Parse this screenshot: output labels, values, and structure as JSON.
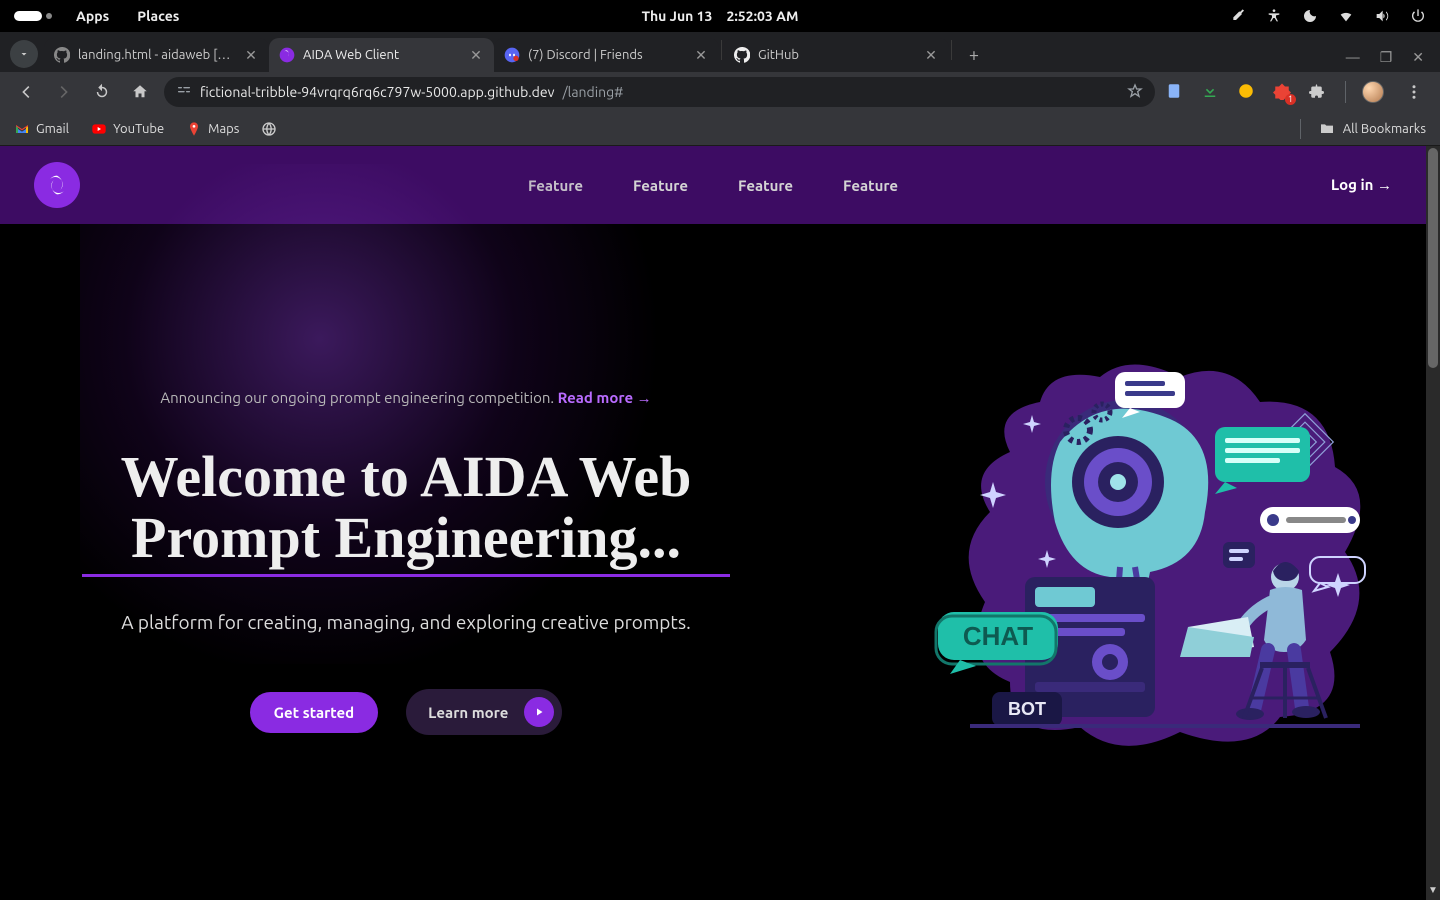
{
  "gnome": {
    "apps": "Apps",
    "places": "Places",
    "date": "Thu Jun 13",
    "time": "2:52:03 AM"
  },
  "chrome": {
    "tabs": [
      {
        "title": "landing.html - aidaweb […"
      },
      {
        "title": "AIDA Web Client"
      },
      {
        "title": "(7) Discord | Friends"
      },
      {
        "title": "GitHub"
      }
    ],
    "url_main": "fictional-tribble-94vrqrq6rq6c797w-5000.app.github.dev",
    "url_tail": "/landing#",
    "ext_badge_count": "1",
    "bookmarks": {
      "gmail": "Gmail",
      "youtube": "YouTube",
      "maps": "Maps",
      "all": "All Bookmarks"
    }
  },
  "site": {
    "nav_items": [
      "Feature",
      "Feature",
      "Feature",
      "Feature"
    ],
    "login": "Log in →"
  },
  "hero": {
    "announce_text": "Announcing our ongoing prompt engineering competition. ",
    "announce_link": "Read more →",
    "title_line1": "Welcome to AIDA Web",
    "title_line2": "Prompt Engineering...",
    "subtitle": "A platform for creating, managing, and exploring creative prompts.",
    "cta_primary": "Get started",
    "cta_secondary": "Learn more",
    "chat_pill": "CHAT",
    "bot_pill": "BOT"
  }
}
